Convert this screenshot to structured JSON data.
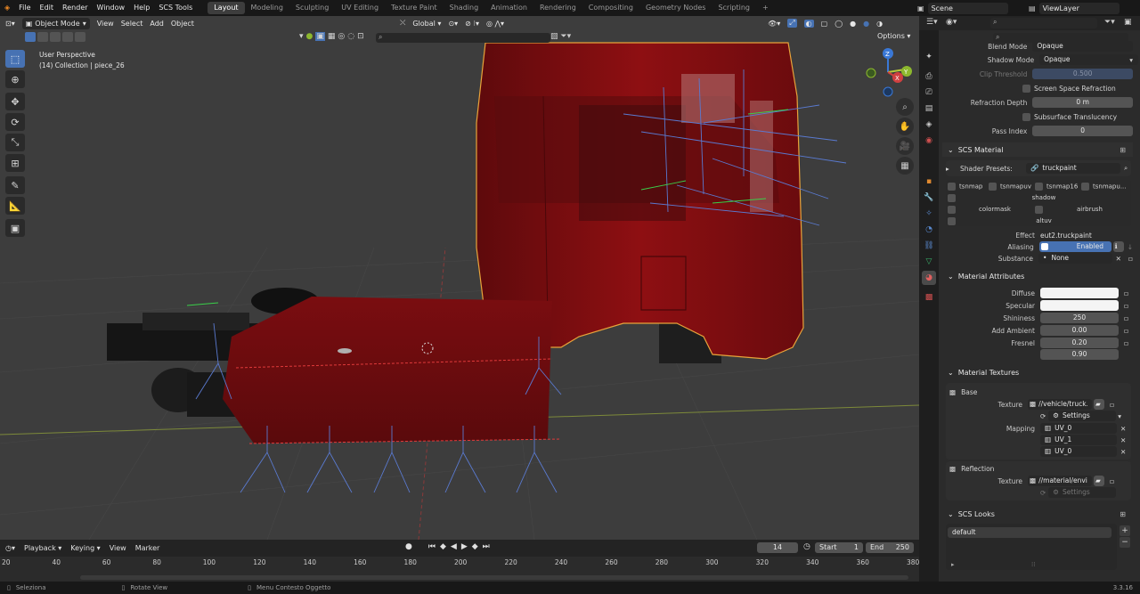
{
  "menu": {
    "items": [
      "File",
      "Edit",
      "Render",
      "Window",
      "Help",
      "SCS Tools"
    ]
  },
  "workspaces": [
    "Layout",
    "Modeling",
    "Sculpting",
    "UV Editing",
    "Texture Paint",
    "Shading",
    "Animation",
    "Rendering",
    "Compositing",
    "Geometry Nodes",
    "Scripting"
  ],
  "scene": {
    "name": "Scene",
    "view_layer": "ViewLayer"
  },
  "viewport": {
    "mode": "Object Mode",
    "menu": [
      "View",
      "Select",
      "Add",
      "Object"
    ],
    "transform_orientation": "Global",
    "options_label": "Options",
    "view_name": "User Perspective",
    "collection_info": "(14) Collection | piece_26",
    "axis": {
      "x": "X",
      "y": "Y",
      "z": "Z"
    }
  },
  "properties": {
    "blend_mode": {
      "label": "Blend Mode",
      "value": "Opaque"
    },
    "shadow_mode": {
      "label": "Shadow Mode",
      "value": "Opaque"
    },
    "clip_threshold": {
      "label": "Clip Threshold",
      "value": "0.500"
    },
    "screen_space_refraction": "Screen Space Refraction",
    "refraction_depth": {
      "label": "Refraction Depth",
      "value": "0 m"
    },
    "subsurface_translucency": "Subsurface Translucency",
    "pass_index": {
      "label": "Pass Index",
      "value": "0"
    },
    "scs_material": {
      "title": "SCS Material",
      "shader_presets_label": "Shader Presets:",
      "shader_preset": "truckpaint",
      "flags_row1": [
        "tsnmap",
        "tsnmapuv",
        "tsnmap16",
        "tsnmapu..."
      ],
      "flag_shadow": "shadow",
      "flag_colormask": "colormask",
      "flag_airbrush": "airbrush",
      "flag_altuv": "altuv",
      "effect_label": "Effect",
      "effect_value": "eut2.truckpaint",
      "aliasing_label": "Aliasing",
      "aliasing_value": "Enabled",
      "substance_label": "Substance",
      "substance_value": "None"
    },
    "material_attributes": {
      "title": "Material Attributes",
      "diffuse_label": "Diffuse",
      "specular_label": "Specular",
      "shininess_label": "Shininess",
      "shininess_value": "250",
      "add_ambient_label": "Add Ambient",
      "add_ambient_value": "0.00",
      "fresnel_label": "Fresnel",
      "fresnel_value1": "0.20",
      "fresnel_value2": "0.90"
    },
    "material_textures": {
      "title": "Material Textures",
      "base_title": "Base",
      "texture_label": "Texture",
      "base_texture": "//vehicle/truck...",
      "settings_label": "Settings",
      "mapping_label": "Mapping",
      "mappings": [
        "UV_0",
        "UV_1",
        "UV_0"
      ],
      "reflection_title": "Reflection",
      "reflection_texture": "//material/envi..."
    },
    "scs_looks": {
      "title": "SCS Looks",
      "item": "default"
    }
  },
  "timeline": {
    "menu": [
      "Playback",
      "Keying",
      "View",
      "Marker"
    ],
    "current_frame": "14",
    "start_label": "Start",
    "start": "1",
    "end_label": "End",
    "end": "250",
    "ticks": [
      "20",
      "40",
      "60",
      "80",
      "100",
      "120",
      "140",
      "160",
      "180",
      "200",
      "220",
      "240",
      "260",
      "280",
      "300",
      "320",
      "340",
      "360",
      "380"
    ]
  },
  "status": {
    "select": "Seleziona",
    "rotate": "Rotate View",
    "context": "Menu Contesto Oggetto",
    "version": "3.3.16"
  },
  "colors": {
    "accent": "#4772b3",
    "truck_red": "#8e0f12",
    "selection_outline": "#e8a33a"
  }
}
